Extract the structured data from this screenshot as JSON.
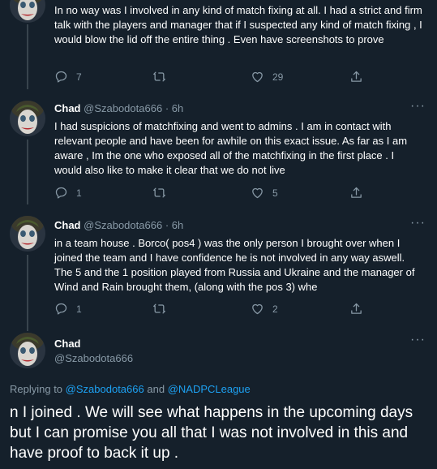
{
  "tweets": [
    {
      "text": "In no way was I involved in any kind of match fixing at all.  I had a strict and firm talk with the players and manager that if I suspected any kind of match fixing , I would blow the lid off the entire thing . Even have screenshots to prove",
      "replies": "7",
      "likes": "29"
    },
    {
      "name": "Chad",
      "handle": "@Szabodota666",
      "separator": "·",
      "time": "6h",
      "text": "I had suspicions of matchfixing and went to admins . I am in contact with relevant people and have been for awhile on this exact issue. As far as I am aware , Im the one who exposed all of the matchfixing in the first place . I would also like to make it clear that we do not live",
      "replies": "1",
      "likes": "5"
    },
    {
      "name": "Chad",
      "handle": "@Szabodota666",
      "separator": "·",
      "time": "6h",
      "text": "in a team house . Borco( pos4 ) was the only person I brought over when I joined the team and I have confidence he is not involved in any way aswell. The 5 and the 1 position played from Russia and Ukraine and the manager of Wind and Rain brought them, (along with the pos 3) whe",
      "replies": "1",
      "likes": "2"
    }
  ],
  "main_tweet": {
    "name": "Chad",
    "handle": "@Szabodota666",
    "replying_prefix": "Replying to",
    "reply_to_1": "@Szabodota666",
    "reply_and": "and",
    "reply_to_2": "@NADPCLeague",
    "text": "n I joined . We will see what happens in the upcoming days but I can promise you all that I was not involved in this and have proof to back it up ."
  },
  "more_label": "···",
  "colors": {
    "background": "#15202b",
    "muted": "#8899a6",
    "link": "#1da1f2",
    "divider": "#38444d"
  },
  "icons": [
    "avatar",
    "reply-icon",
    "retweet-icon",
    "like-icon",
    "share-icon",
    "more-icon"
  ]
}
